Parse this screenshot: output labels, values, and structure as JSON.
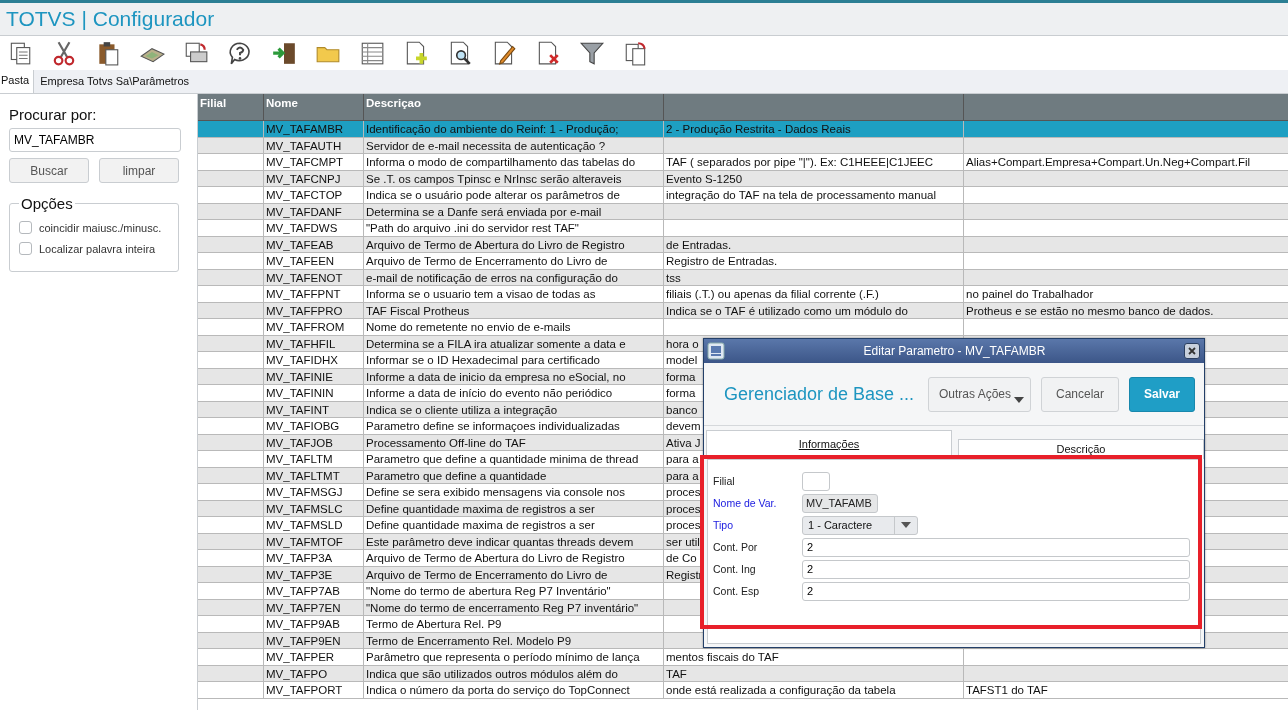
{
  "window": {
    "title": "TOTVS | Configurador"
  },
  "tabs": [
    {
      "label": "Pasta",
      "selected": true
    }
  ],
  "path": "Empresa Totvs Sa\\Parâmetros",
  "search": {
    "label": "Procurar por:",
    "value": "MV_TAFAMBR",
    "buttons": [
      "Buscar",
      "limpar"
    ]
  },
  "options": {
    "title": "Opções",
    "items": [
      {
        "label": "coincidir maiusc./minusc.",
        "checked": false
      },
      {
        "label": "Localizar palavra inteira",
        "checked": false
      }
    ]
  },
  "table": {
    "columns": [
      "Filial",
      "Nome",
      "Descriçao"
    ],
    "rows": [
      {
        "name": "MV_TAFAMBR",
        "description": "Identificação do ambiente do Reinf: 1 - Produção;",
        "column_4": "2 - Produção Restrita - Dados Reais",
        "selected": true
      },
      {
        "name": "MV_TAFAUTH",
        "description": "Servidor de e-mail necessita de autenticação ?",
        "selected": false
      },
      {
        "name": "MV_TAFCMPT",
        "description": "Informa o modo de compartilhamento das tabelas do",
        "column_4": "TAF ( separados por pipe \"|\"). Ex:  C1HEEE|C1JEEC",
        "column_5": "Alias+Compart.Empresa+Compart.Un.Neg+Compart.Fil",
        "selected": false
      },
      {
        "name": "MV_TAFCNPJ",
        "description": "Se .T. os campos Tpinsc e NrInsc serão alteraveis",
        "column_4": "Evento S-1250",
        "selected": false
      },
      {
        "name": "MV_TAFCTOP",
        "description": "Indica se o usuário pode alterar os parâmetros de",
        "column_4": "integração do TAF na tela de processamento manual",
        "selected": false
      },
      {
        "name": "MV_TAFDANF",
        "description": "Determina se a Danfe será enviada por e-mail",
        "selected": false
      },
      {
        "name": "MV_TAFDWS",
        "description": "\"Path do arquivo .ini do servidor rest TAF\"",
        "selected": false
      },
      {
        "name": "MV_TAFEAB",
        "description": "Arquivo de Termo de Abertura do Livro de Registro",
        "column_4": "de Entradas.",
        "selected": false
      },
      {
        "name": "MV_TAFEEN",
        "description": "Arquivo de Termo de Encerramento do Livro de",
        "column_4": "Registro de Entradas.",
        "selected": false
      },
      {
        "name": "MV_TAFENOT",
        "description": "e-mail de notificação de erros na configuração do",
        "column_4": "tss",
        "selected": false
      },
      {
        "name": "MV_TAFFPNT",
        "description": "Informa se o usuario tem a visao de todas as",
        "column_4": "filiais (.T.) ou apenas da filial corrente (.F.)",
        "column_5": "no painel do Trabalhador",
        "selected": false
      },
      {
        "name": "MV_TAFFPRO",
        "description": "TAF Fiscal Protheus",
        "column_4": "Indica se o TAF é utilizado como um módulo do",
        "column_5": "Protheus e se estão no mesmo banco de dados.",
        "selected": false
      },
      {
        "name": "MV_TAFFROM",
        "description": "Nome do remetente no envio de e-mails",
        "selected": false
      },
      {
        "name": "MV_TAFHFIL",
        "description": "Determina se a FILA ira atualizar somente a data e",
        "column_4": "hora o",
        "selected": false
      },
      {
        "name": "MV_TAFIDHX",
        "description": "Informar se o ID Hexadecimal para certificado",
        "column_4": "model",
        "selected": false
      },
      {
        "name": "MV_TAFINIE",
        "description": "Informe a data de inicio da empresa no eSocial, no",
        "column_4": "forma",
        "selected": false
      },
      {
        "name": "MV_TAFININ",
        "description": "Informe a data de início do evento não periódico",
        "column_4": "forma",
        "selected": false
      },
      {
        "name": "MV_TAFINT",
        "description": "Indica se o cliente utiliza a integração",
        "column_4": "banco",
        "selected": false
      },
      {
        "name": "MV_TAFIOBG",
        "description": "Parametro define se informaçoes individualizadas",
        "column_4": "devem",
        "selected": false
      },
      {
        "name": "MV_TAFJOB",
        "description": "Processamento Off-line do TAF",
        "column_4": "Ativa J",
        "selected": false
      },
      {
        "name": "MV_TAFLTM",
        "description": "Parametro que define a quantidade minima de thread",
        "column_4": "para a",
        "selected": false
      },
      {
        "name": "MV_TAFLTMT",
        "description": "Parametro que define a quantidade",
        "column_4": "para a",
        "selected": false
      },
      {
        "name": "MV_TAFMSGJ",
        "description": "Define se sera exibido mensagens via console nos",
        "column_4": "proces",
        "selected": false
      },
      {
        "name": "MV_TAFMSLC",
        "description": "Define quantidade maxima de registros a ser",
        "column_4": "proces",
        "selected": false
      },
      {
        "name": "MV_TAFMSLD",
        "description": "Define quantidade maxima de registros a ser",
        "column_4": "proces",
        "selected": false
      },
      {
        "name": "MV_TAFMTOF",
        "description": "Este parâmetro deve indicar quantas threads devem",
        "column_4": "ser util",
        "selected": false
      },
      {
        "name": "MV_TAFP3A",
        "description": "Arquivo de Termo de Abertura do Livro de Registro",
        "column_4": "de Co",
        "selected": false
      },
      {
        "name": "MV_TAFP3E",
        "description": "Arquivo de Termo de Encerramento do Livro de",
        "column_4": "Registr",
        "selected": false
      },
      {
        "name": "MV_TAFP7AB",
        "description": "\"Nome do termo de abertura Reg P7 Inventário\"",
        "selected": false
      },
      {
        "name": "MV_TAFP7EN",
        "description": "\"Nome do termo de encerramento Reg P7 inventário\"",
        "selected": false
      },
      {
        "name": "MV_TAFP9AB",
        "description": "Termo de Abertura Rel. P9",
        "selected": false
      },
      {
        "name": "MV_TAFP9EN",
        "description": "Termo de Encerramento Rel. Modelo P9",
        "selected": false
      },
      {
        "name": "MV_TAFPER",
        "description": "Parâmetro que representa o período mínimo de lança",
        "column_4": "mentos fiscais do TAF",
        "selected": false
      },
      {
        "name": "MV_TAFPO",
        "description": "Indica que são utilizados outros módulos além do",
        "column_4": "TAF",
        "selected": false
      },
      {
        "name": "MV_TAFPORT",
        "description": "Indica o número da porta do serviço do TopConnect",
        "column_4": "onde está realizada a configuração da tabela",
        "column_5": "TAFST1 do TAF",
        "selected": false
      }
    ]
  },
  "dialog": {
    "title": "Editar Parametro - MV_TAFAMBR",
    "heading": "Gerenciador de Base ...",
    "buttons": [
      {
        "label": "Outras Ações",
        "kind": "menu"
      },
      {
        "label": "Cancelar",
        "kind": "default"
      },
      {
        "label": "Salvar",
        "kind": "primary"
      }
    ],
    "tabs": [
      {
        "label": "Informações",
        "selected": true
      },
      {
        "label": "Descrição",
        "selected": false
      }
    ],
    "fields": [
      {
        "label": "Filial",
        "kind": "short",
        "required": false,
        "disabled": false
      },
      {
        "label": "Nome de Var.",
        "kind": "short",
        "value": "MV_TAFAMB",
        "required": true,
        "disabled": true
      },
      {
        "label": "Tipo",
        "kind": "select",
        "value": "1 - Caractere",
        "required": true,
        "disabled": false
      },
      {
        "label": "Cont. Por",
        "kind": "wide",
        "value": "2",
        "required": false,
        "disabled": false
      },
      {
        "label": "Cont. Ing",
        "kind": "wide",
        "value": "2",
        "required": false,
        "disabled": false
      },
      {
        "label": "Cont. Esp",
        "kind": "wide",
        "value": "2",
        "required": false,
        "disabled": false
      }
    ]
  }
}
